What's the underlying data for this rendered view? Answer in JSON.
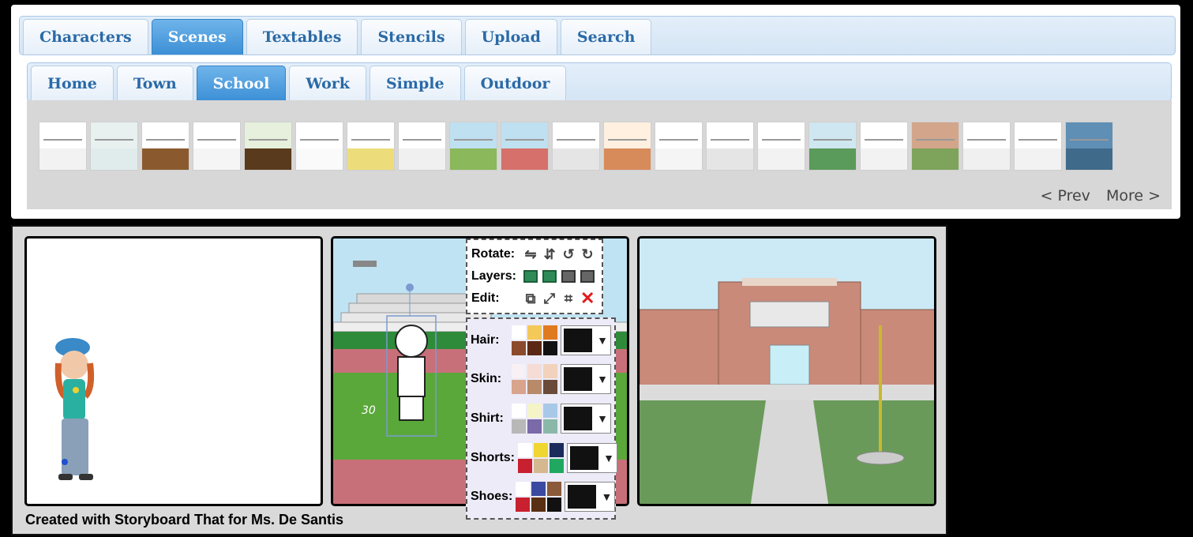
{
  "tabs_main": [
    "Characters",
    "Scenes",
    "Textables",
    "Stencils",
    "Upload",
    "Search"
  ],
  "tabs_main_active": "Scenes",
  "tabs_sub": [
    "Home",
    "Town",
    "School",
    "Work",
    "Simple",
    "Outdoor"
  ],
  "tabs_sub_active": "School",
  "thumbnails": [
    {
      "top": "#ffffff",
      "bottom": "#f2f2f2"
    },
    {
      "top": "#e8f0f0",
      "bottom": "#e0ecec"
    },
    {
      "top": "#ffffff",
      "bottom": "#8a5a2e"
    },
    {
      "top": "#ffffff",
      "bottom": "#f5f5f5"
    },
    {
      "top": "#e6f0dc",
      "bottom": "#5a3a1c"
    },
    {
      "top": "#ffffff",
      "bottom": "#fafafa"
    },
    {
      "top": "#ffffff",
      "bottom": "#eddd7a"
    },
    {
      "top": "#ffffff",
      "bottom": "#f0f0f0"
    },
    {
      "top": "#bfe0f0",
      "bottom": "#8ab85a"
    },
    {
      "top": "#bfe0f0",
      "bottom": "#d6706a"
    },
    {
      "top": "#ffffff",
      "bottom": "#e5e5e5"
    },
    {
      "top": "#fff0e0",
      "bottom": "#d88b5a"
    },
    {
      "top": "#ffffff",
      "bottom": "#f5f5f5"
    },
    {
      "top": "#ffffff",
      "bottom": "#e5e5e5"
    },
    {
      "top": "#ffffff",
      "bottom": "#f2f2f2"
    },
    {
      "top": "#cfe7f0",
      "bottom": "#5a9a5a"
    },
    {
      "top": "#ffffff",
      "bottom": "#f2f2f2"
    },
    {
      "top": "#d3a58a",
      "bottom": "#7ea35a"
    },
    {
      "top": "#ffffff",
      "bottom": "#f0f0f0"
    },
    {
      "top": "#ffffff",
      "bottom": "#f2f2f2"
    },
    {
      "top": "#5f8fb5",
      "bottom": "#3f6a8a"
    }
  ],
  "pager": {
    "prev": "< Prev",
    "next": "More >"
  },
  "toolbox": {
    "rotate_label": "Rotate:",
    "layers_label": "Layers:",
    "edit_label": "Edit:"
  },
  "color_rows": [
    {
      "label": "Hair:",
      "swatches": [
        "#ffffff",
        "#f5c85a",
        "#e07a1e",
        "#8b4a2b",
        "#5a2814",
        "#111111"
      ],
      "current": "#111111"
    },
    {
      "label": "Skin:",
      "swatches": [
        "#f7f0f4",
        "#f5dcd4",
        "#f2d2bc",
        "#d8a48c",
        "#b88a6a",
        "#6a4a3a"
      ],
      "current": "#111111"
    },
    {
      "label": "Shirt:",
      "swatches": [
        "#ffffff",
        "#f4f4c8",
        "#a8c8e8",
        "#b8b8b8",
        "#7a6aa8",
        "#8ab8a8"
      ],
      "current": "#111111"
    },
    {
      "label": "Shorts:",
      "swatches": [
        "#ffffff",
        "#f0d630",
        "#1a2a5a",
        "#c8202e",
        "#d4b890",
        "#20a860"
      ],
      "current": "#111111"
    },
    {
      "label": "Shoes:",
      "swatches": [
        "#ffffff",
        "#3a4aa0",
        "#8a5a3a",
        "#c8202e",
        "#5a3014",
        "#111111"
      ],
      "current": "#111111"
    }
  ],
  "caption": "Created with Storyboard That for Ms. De Santis"
}
